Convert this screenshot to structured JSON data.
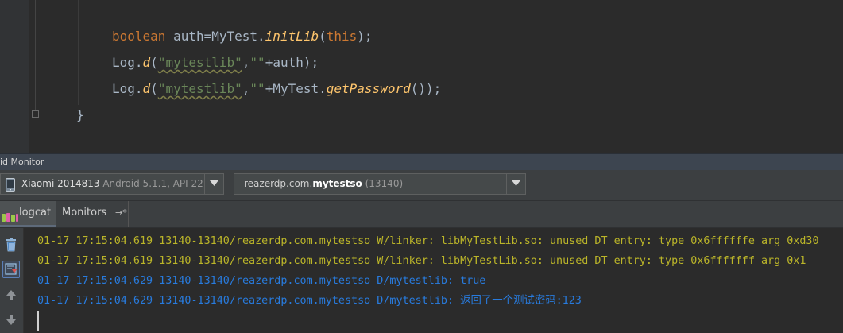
{
  "editor": {
    "lines": [
      {
        "t1": "boolean",
        "t2": " auth=MyTest.",
        "t3": "initLib",
        "t4": "(",
        "t5": "this",
        "t6": ");"
      },
      {
        "t1": "Log.",
        "t2": "d",
        "t3": "(",
        "t4": "\"mytestlib\"",
        "t5": ",",
        "t6": "\"\"",
        "t7": "+auth);"
      },
      {
        "t1": "Log.",
        "t2": "d",
        "t3": "(",
        "t4": "\"mytestlib\"",
        "t5": ",",
        "t6": "\"\"",
        "t7": "+MyTest.",
        "t8": "getPassword",
        "t9": "());"
      },
      {
        "t1": "}"
      }
    ]
  },
  "monitor": {
    "title": "id Monitor",
    "device": {
      "name": "Xiaomi 2014813",
      "detail": " Android 5.1.1, API 22"
    },
    "process": {
      "prefix": "reazerdp.com.",
      "bold": "mytestso",
      "pid": " (13140)"
    },
    "tabs": {
      "logcat": "logcat",
      "monitors": "Monitors",
      "pin": "→*"
    }
  },
  "log": {
    "lines": [
      {
        "text": "01-17 17:15:04.619 13140-13140/reazerdp.com.mytestso W/linker: libMyTestLib.so: unused DT entry: type 0x6ffffffe arg 0xd30",
        "color": "#bbb529"
      },
      {
        "text": "01-17 17:15:04.619 13140-13140/reazerdp.com.mytestso W/linker: libMyTestLib.so: unused DT entry: type 0x6fffffff arg 0x1",
        "color": "#bbb529"
      },
      {
        "text": "01-17 17:15:04.629 13140-13140/reazerdp.com.mytestso D/mytestlib: true",
        "color": "#287bde"
      },
      {
        "text": "01-17 17:15:04.629 13140-13140/reazerdp.com.mytestso D/mytestlib: 返回了一个测试密码:123",
        "color": "#287bde"
      }
    ]
  },
  "colors": {
    "editor_bg": "#2b2b2b",
    "keyword": "#cc7832",
    "function": "#ffc66d",
    "string": "#6a8759",
    "text": "#a9b7c6",
    "warn": "#bbb529",
    "debug": "#287bde"
  },
  "icons": {
    "device": "phone-icon",
    "combo": "dropdown-arrow-icon",
    "logcat": "logcat-icon",
    "toolbar": [
      "trash-icon",
      "scroll-to-end-icon",
      "up-arrow-icon",
      "down-arrow-icon"
    ]
  }
}
